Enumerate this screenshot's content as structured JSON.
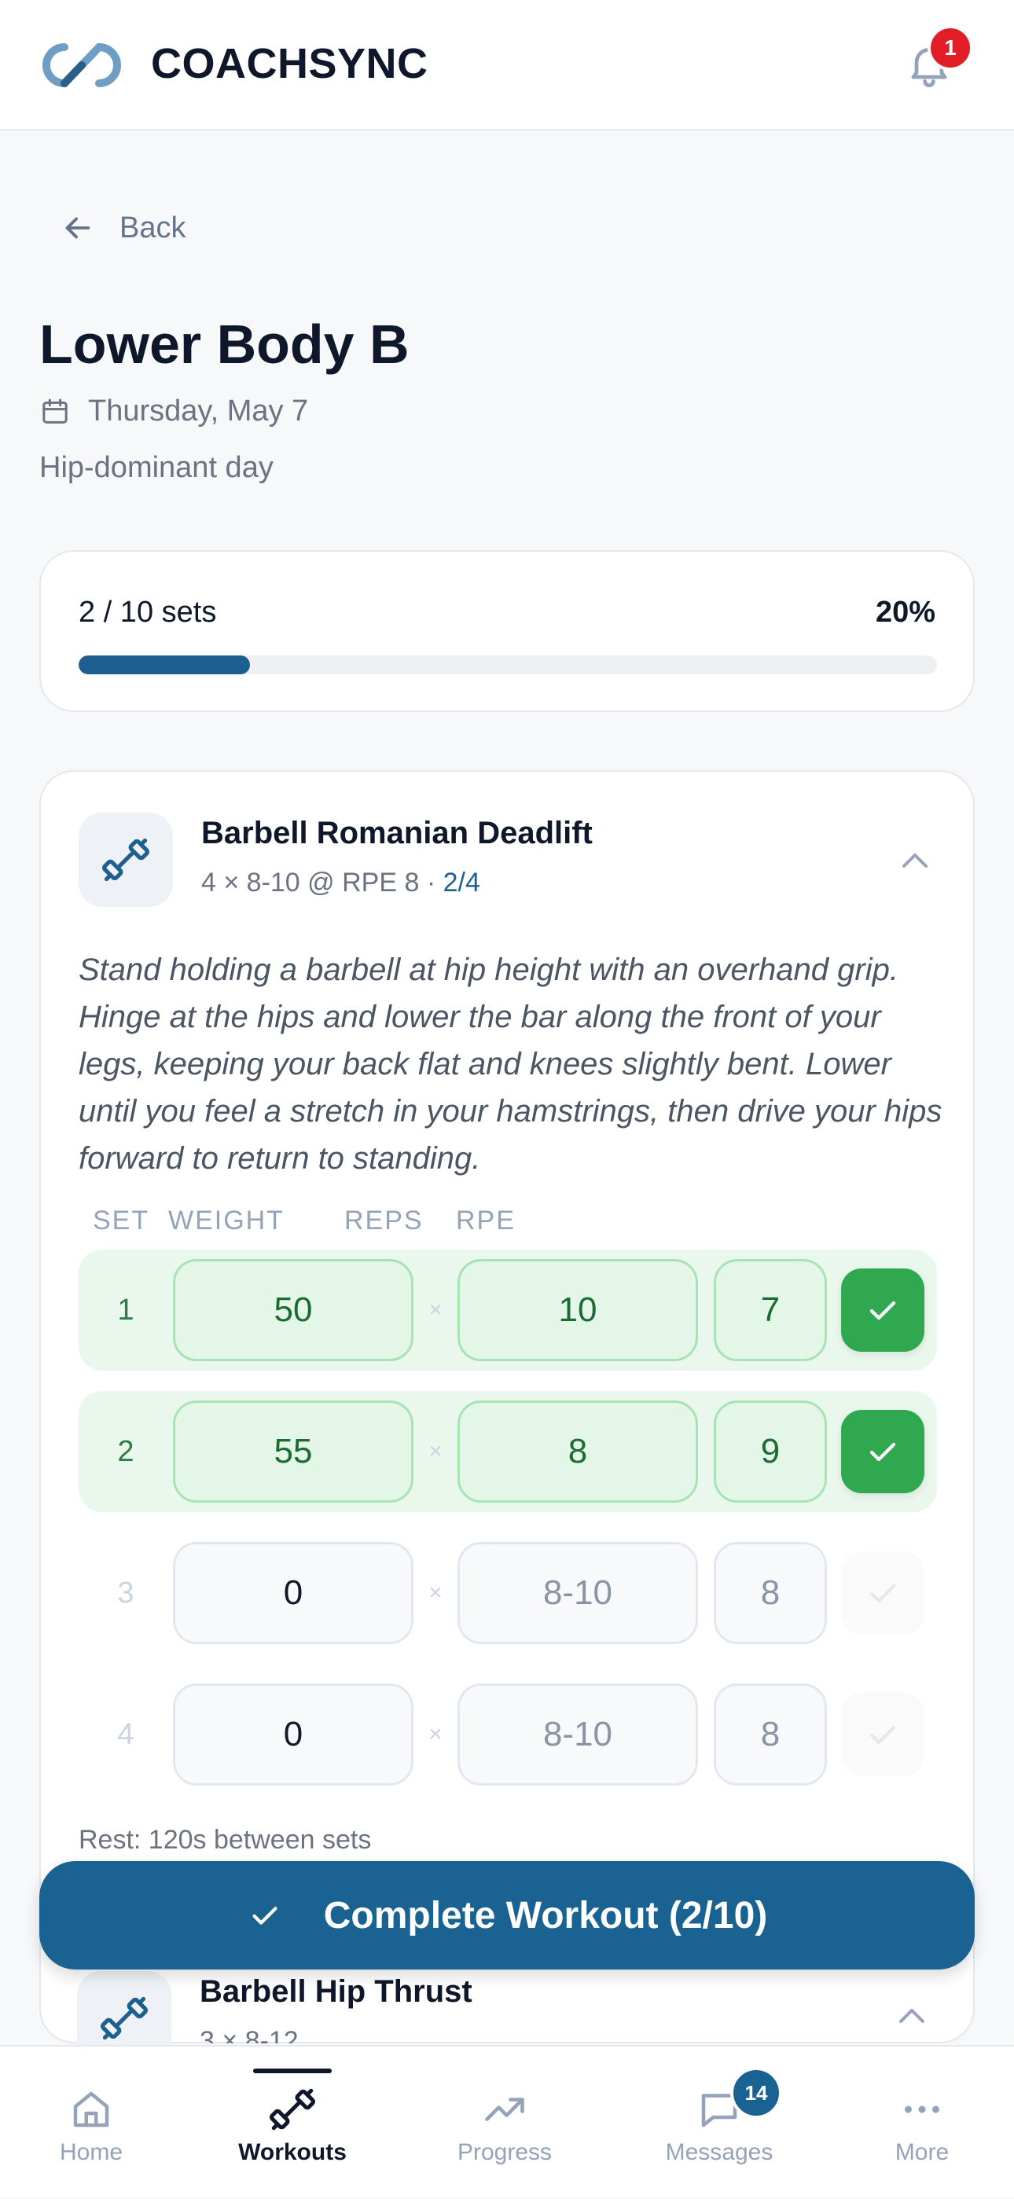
{
  "header": {
    "brand": "COACHSYNC",
    "notification_count": "1"
  },
  "back_label": "Back",
  "workout": {
    "title": "Lower Body B",
    "date": "Thursday, May 7",
    "subtitle": "Hip-dominant day"
  },
  "progress": {
    "label": "2 / 10 sets",
    "percent_label": "20%",
    "fraction": 0.2
  },
  "exercise": {
    "name": "Barbell Romanian Deadlift",
    "prescription": "4 × 8-10 @ RPE 8 · ",
    "progress": "2/4",
    "description": "Stand holding a barbell at hip height with an overhand grip. Hinge at the hips and lower the bar along the front of your legs, keeping your back flat and knees slightly bent. Lower until you feel a stretch in your hamstrings, then drive your hips forward to return to standing.",
    "columns": {
      "set": "SET",
      "weight": "WEIGHT",
      "reps": "REPS",
      "rpe": "RPE"
    },
    "separator": "×",
    "sets": [
      {
        "num": "1",
        "weight": "50",
        "reps": "10",
        "rpe": "7",
        "done": true
      },
      {
        "num": "2",
        "weight": "55",
        "reps": "8",
        "rpe": "9",
        "done": true
      },
      {
        "num": "3",
        "weight": "0",
        "reps": "8-10",
        "rpe": "8",
        "done": false
      },
      {
        "num": "4",
        "weight": "0",
        "reps": "8-10",
        "rpe": "8",
        "done": false
      }
    ],
    "rest_note": "Rest: 120s between sets"
  },
  "complete_button": "Complete Workout (2/10)",
  "next_exercise": {
    "name": "Barbell Hip Thrust",
    "prescription": "3 × 8-12"
  },
  "nav": {
    "items": [
      {
        "label": "Home",
        "icon": "home-icon"
      },
      {
        "label": "Workouts",
        "icon": "dumbbell-icon",
        "active": true
      },
      {
        "label": "Progress",
        "icon": "trending-up-icon"
      },
      {
        "label": "Messages",
        "icon": "message-icon",
        "badge": "14"
      },
      {
        "label": "More",
        "icon": "more-icon"
      }
    ]
  },
  "colors": {
    "primary": "#1a6291",
    "success": "#2fa84f",
    "badge_red": "#e11d28"
  }
}
